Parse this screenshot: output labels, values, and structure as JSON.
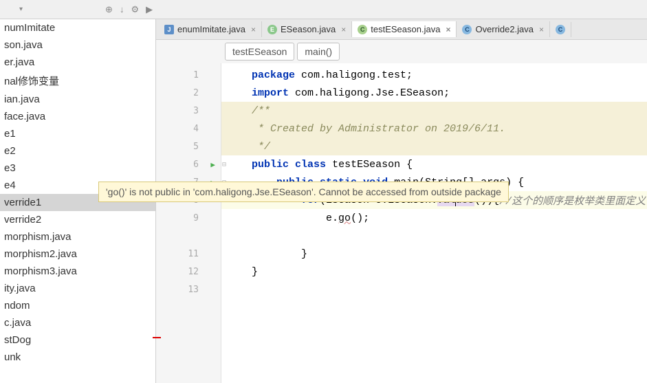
{
  "toolbar": {
    "icons": [
      "⊕",
      "↓",
      "⚙",
      "▶"
    ]
  },
  "sidebar": {
    "items": [
      "numImitate",
      "son.java",
      "er.java",
      "nal修饰变量",
      "ian.java",
      "face.java",
      "e1",
      "e2",
      "e3",
      "e4",
      "verride1",
      "verride2",
      "morphism.java",
      "morphism2.java",
      "morphism3.java",
      "ity.java",
      "ndom",
      "c.java",
      "stDog",
      "unk"
    ],
    "selected_index": 10
  },
  "tabs": {
    "items": [
      {
        "icon": "j",
        "label": "enumImitate.java",
        "active": false
      },
      {
        "icon": "e",
        "label": "ESeason.java",
        "active": false
      },
      {
        "icon": "c",
        "label": "testESeason.java",
        "active": true
      },
      {
        "icon": "c-blue",
        "label": "Override2.java",
        "active": false
      },
      {
        "icon": "c-blue",
        "label": "",
        "active": false
      }
    ]
  },
  "breadcrumb": {
    "items": [
      "testESeason",
      "main()"
    ]
  },
  "gutter": {
    "lines": [
      {
        "n": "1"
      },
      {
        "n": "2"
      },
      {
        "n": "3",
        "fold": true
      },
      {
        "n": "4"
      },
      {
        "n": "5"
      },
      {
        "n": "6",
        "run": true,
        "fold": true
      },
      {
        "n": "7",
        "run": true,
        "fold": true
      },
      {
        "n": "8"
      },
      {
        "n": "9"
      },
      {
        "n": ""
      },
      {
        "n": "11"
      },
      {
        "n": "12"
      },
      {
        "n": "13"
      }
    ]
  },
  "code": {
    "line1_indent": "    ",
    "line1_kw": "package",
    "line1_rest": " com.haligong.test;",
    "line2_indent": "    ",
    "line2_kw": "import",
    "line2_rest": " com.haligong.Jse.ESeason;",
    "line3": "    /**",
    "line4": "     * Created by Administrator on 2019/6/11.",
    "line5": "     */",
    "line6_indent": "    ",
    "line6_kw1": "public",
    "line6_kw2": "class",
    "line6_cls": " testESeason {",
    "line7_indent": "        ",
    "line7_kw1": "public",
    "line7_kw2": "static",
    "line7_kw3": "void",
    "line7_rest": " main(String[] args) {",
    "line8_indent": "            ",
    "line8_kw": "for",
    "line8_mid": "(ESeason e:ESeason.",
    "line8_method_a": "val",
    "line8_method_b": "ues",
    "line8_after": "()){",
    "line8_comment": "//这个的顺序是枚举类里面定义",
    "line9_indent": "                ",
    "line9_a": "e.",
    "line9_err": "go",
    "line9_b": "();",
    "line11": "            }",
    "line12": "    }",
    "line13": ""
  },
  "tooltip": {
    "text": "'go()' is not public in 'com.haligong.Jse.ESeason'. Cannot be accessed from outside package"
  }
}
